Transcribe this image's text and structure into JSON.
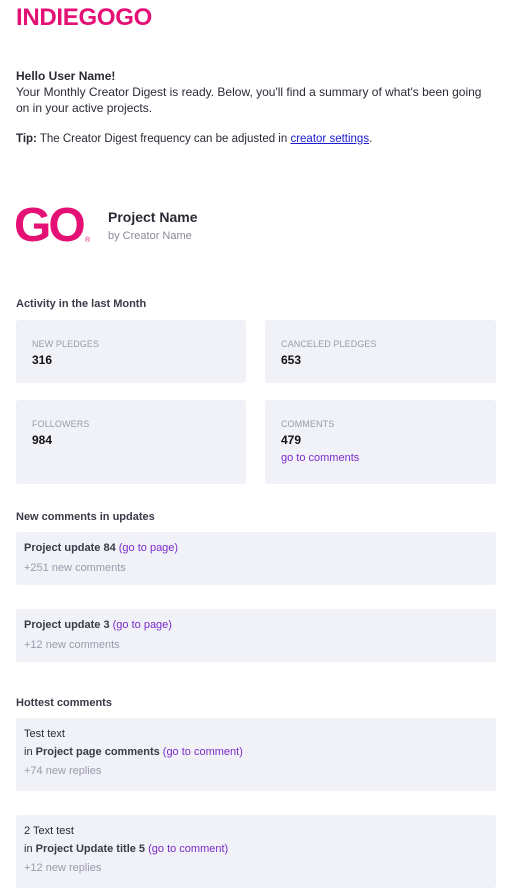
{
  "brand": {
    "logo_text": "INDIEGOGO",
    "go_logo": "GO",
    "registered": "®",
    "accent": "#e51075"
  },
  "intro": {
    "greeting": "Hello User Name!",
    "body": "Your Monthly Creator Digest is ready. Below, you'll find a summary of what's been going on in your active projects.",
    "tip_label": "Tip:",
    "tip_text": " The Creator Digest frequency can be adjusted in ",
    "tip_link": "creator settings",
    "tip_end": "."
  },
  "project": {
    "name": "Project Name",
    "by": "by Creator Name"
  },
  "activity": {
    "heading": "Activity in the last Month",
    "stats": [
      {
        "label": "NEW PLEDGES",
        "value": "316"
      },
      {
        "label": "CANCELED PLEDGES",
        "value": "653"
      },
      {
        "label": "FOLLOWERS",
        "value": "984"
      },
      {
        "label": "COMMENTS",
        "value": "479",
        "link": "go to comments"
      }
    ]
  },
  "update_comments": {
    "heading": "New comments in updates",
    "items": [
      {
        "title": "Project update 84",
        "link": "(go to page)",
        "sub": "+251 new comments"
      },
      {
        "title": "Project update 3",
        "link": "(go to page)",
        "sub": "+12 new comments"
      }
    ]
  },
  "hottest": {
    "heading": "Hottest comments",
    "items": [
      {
        "text": "Test text",
        "in": "in ",
        "where": "Project page comments",
        "link": "(go to comment)",
        "sub": "+74 new replies"
      },
      {
        "text": "2 Text test",
        "in": "in ",
        "where": "Project Update title 5",
        "link": "(go to comment)",
        "sub": "+12 new replies"
      }
    ]
  }
}
